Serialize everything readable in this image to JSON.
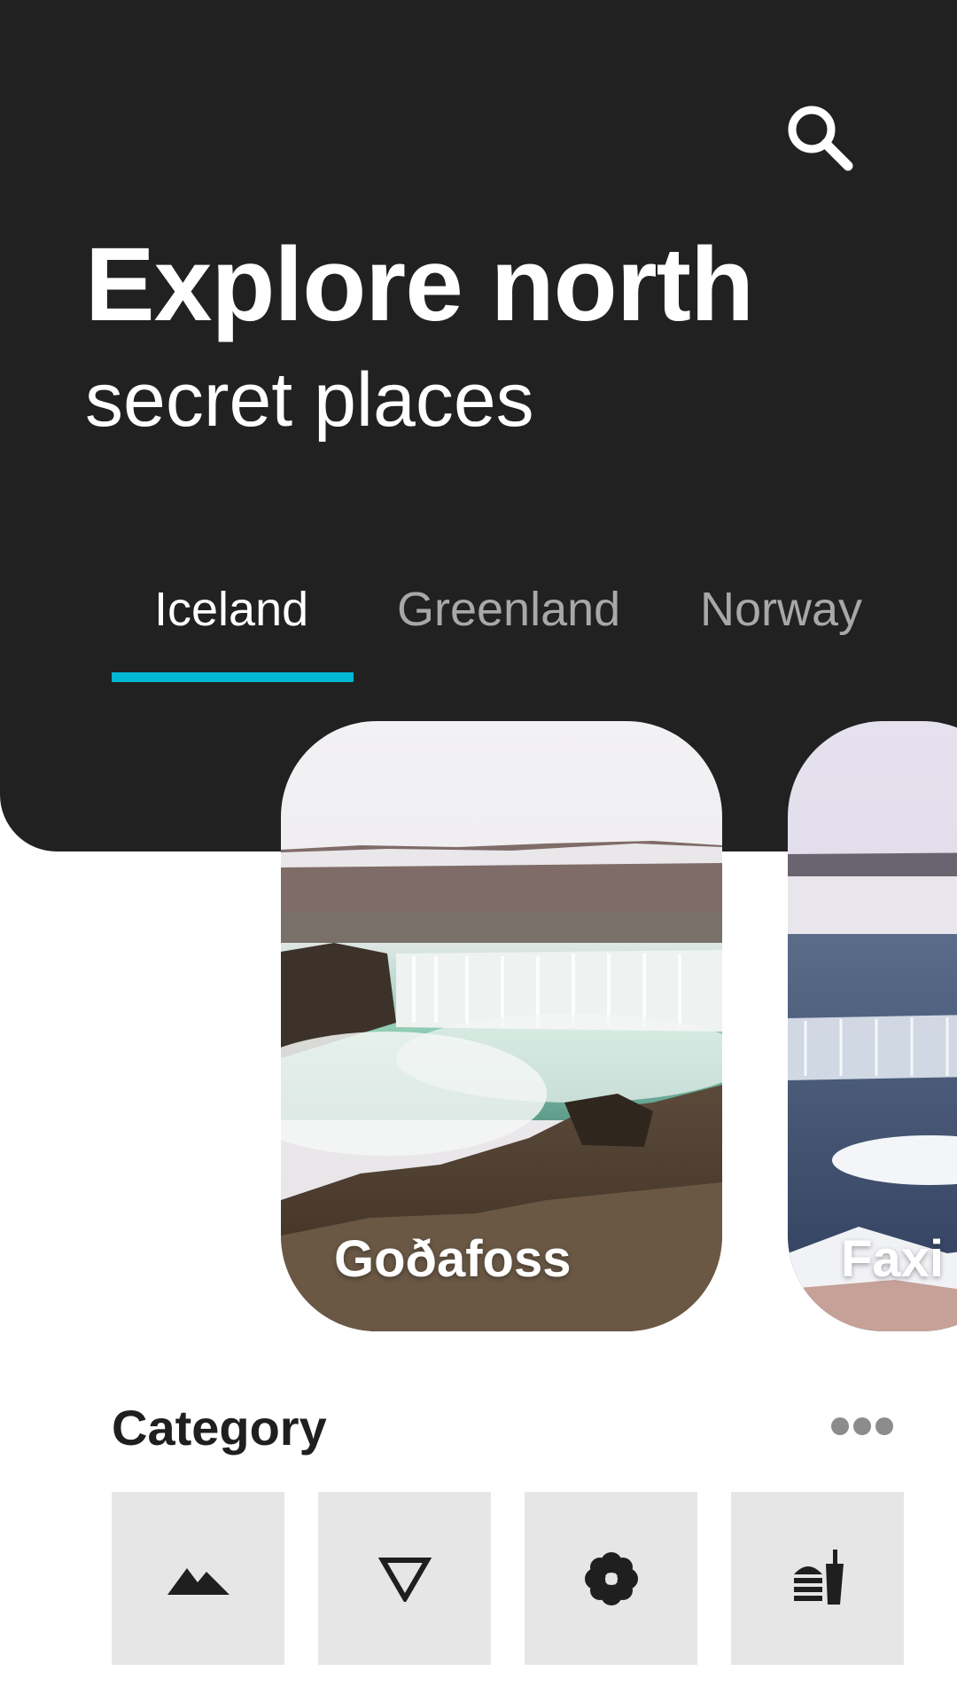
{
  "header": {
    "title": "Explore north",
    "subtitle": "secret places",
    "search_icon": "search-icon",
    "background_color": "#212122"
  },
  "tabs": {
    "items": [
      {
        "label": "Iceland",
        "active": true
      },
      {
        "label": "Greenland",
        "active": false
      },
      {
        "label": "Norway",
        "active": false
      }
    ],
    "indicator_color": "#00b8d4"
  },
  "places": [
    {
      "name": "Goðafoss"
    },
    {
      "name": "Faxi"
    }
  ],
  "category": {
    "heading": "Category",
    "more_icon": "more-horizontal-icon",
    "items": [
      {
        "icon": "mountain-icon"
      },
      {
        "icon": "triangle-down-icon"
      },
      {
        "icon": "flower-icon"
      },
      {
        "icon": "food-icon"
      }
    ]
  }
}
